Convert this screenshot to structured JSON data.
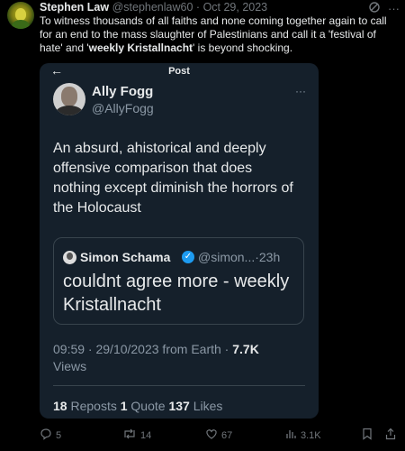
{
  "author": {
    "name": "Stephen Law",
    "handle": "@stephenlaw60",
    "separator": "·",
    "date": "Oct 29, 2023"
  },
  "tweet": {
    "text_part1": "To witness thousands of all faiths and none coming together again to call for an end to the mass slaughter of Palestinians and call it a 'festival of hate' and '",
    "text_bold": "weekly Kristallnacht",
    "text_part2": "' is beyond shocking."
  },
  "embed": {
    "title": "Post",
    "back_icon": "←",
    "more_icon": "···",
    "author_name": "Ally Fogg",
    "author_handle": "@AllyFogg",
    "body": "An absurd, ahistorical and deeply offensive comparison that does nothing except diminish the horrors of the Holocaust",
    "quote": {
      "name": "Simon Schama",
      "verified_icon": "✓",
      "handle_time": "@simon...·23h",
      "body": "couldnt agree more - weekly Kristallnacht"
    },
    "timestamp": "09:59 · 29/10/2023 from Earth · ",
    "views_count": "7.7K",
    "views_label": "Views",
    "reposts_count": "18",
    "reposts_label": "Reposts",
    "quotes_count": "1",
    "quotes_label": "Quote",
    "likes_count": "137",
    "likes_label": "Likes"
  },
  "actions": {
    "reply_count": "5",
    "repost_count": "14",
    "like_count": "67",
    "views_count": "3.1K",
    "reply_icon": "reply-icon",
    "repost_icon": "repost-icon",
    "like_icon": "heart-icon",
    "views_icon": "analytics-icon",
    "bookmark_icon": "bookmark-icon",
    "share_icon": "share-icon"
  },
  "colors": {
    "background": "#000000",
    "card": "#15202b",
    "accent": "#1d9bf0",
    "muted": "#71767b"
  }
}
